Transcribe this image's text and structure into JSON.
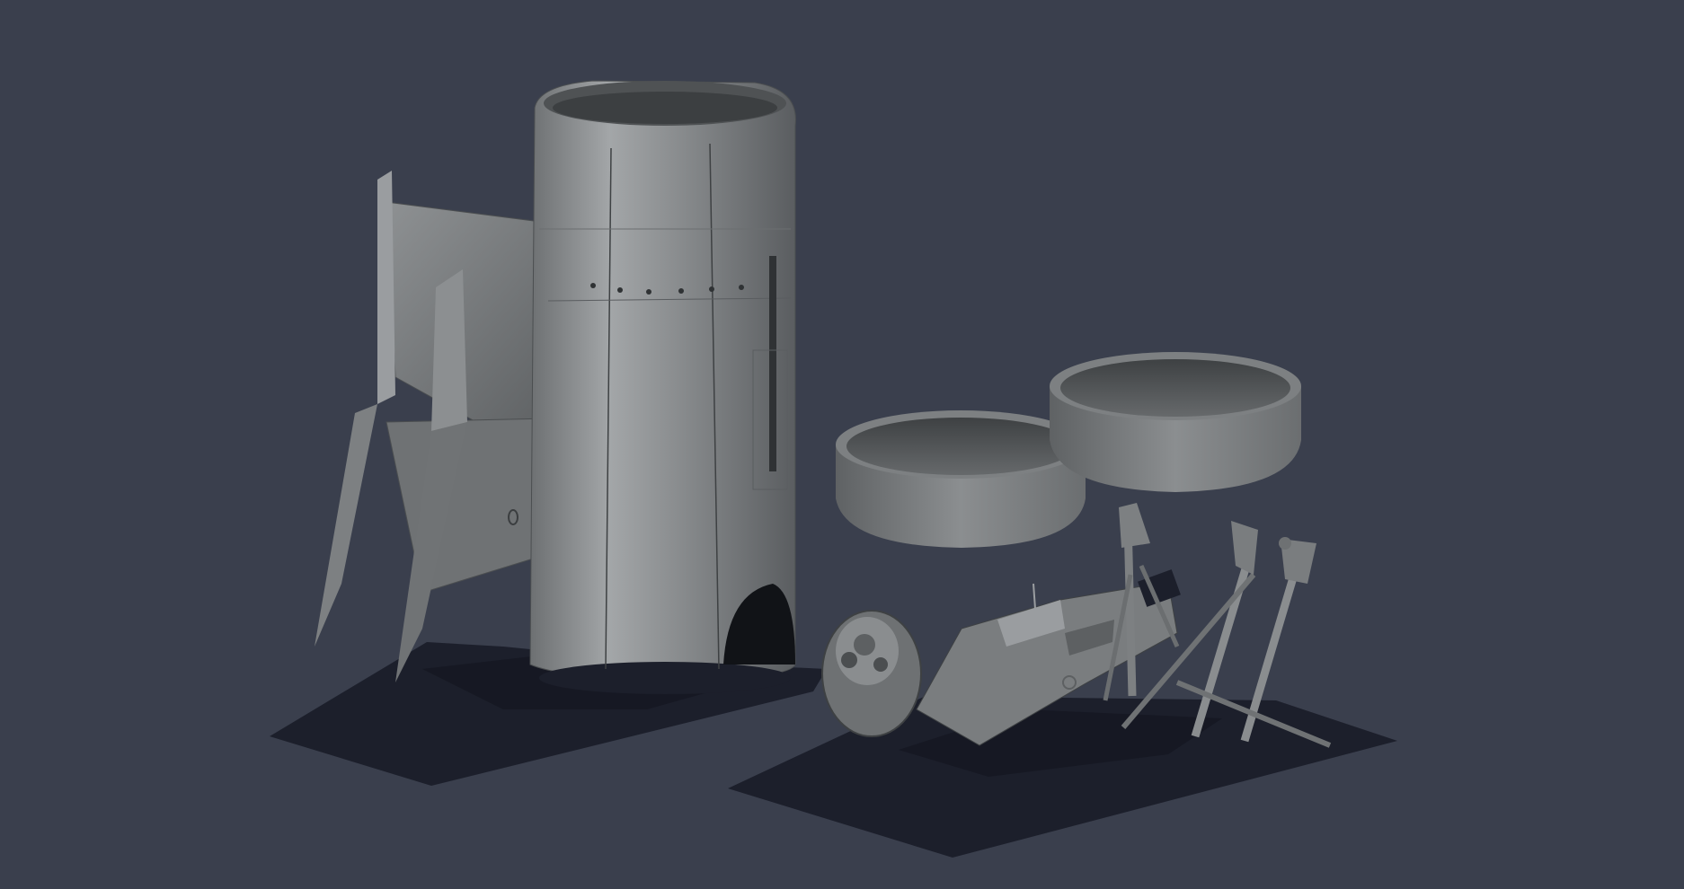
{
  "viewport": {
    "background_color": "#3a3f4d",
    "shadow_color": "#1c1f2b",
    "part_color": "#8c8f91",
    "part_highlight": "#b4b7b9",
    "part_dark": "#4a4c4f"
  },
  "parts": [
    {
      "name": "engine-nacelle-cylinder"
    },
    {
      "name": "fin-flap-assembly"
    },
    {
      "name": "open-ring-left"
    },
    {
      "name": "open-ring-right"
    },
    {
      "name": "wheel-hub"
    },
    {
      "name": "gear-mechanism"
    },
    {
      "name": "landing-gear-struts"
    },
    {
      "name": "base-plate-left"
    },
    {
      "name": "base-plate-right"
    }
  ]
}
